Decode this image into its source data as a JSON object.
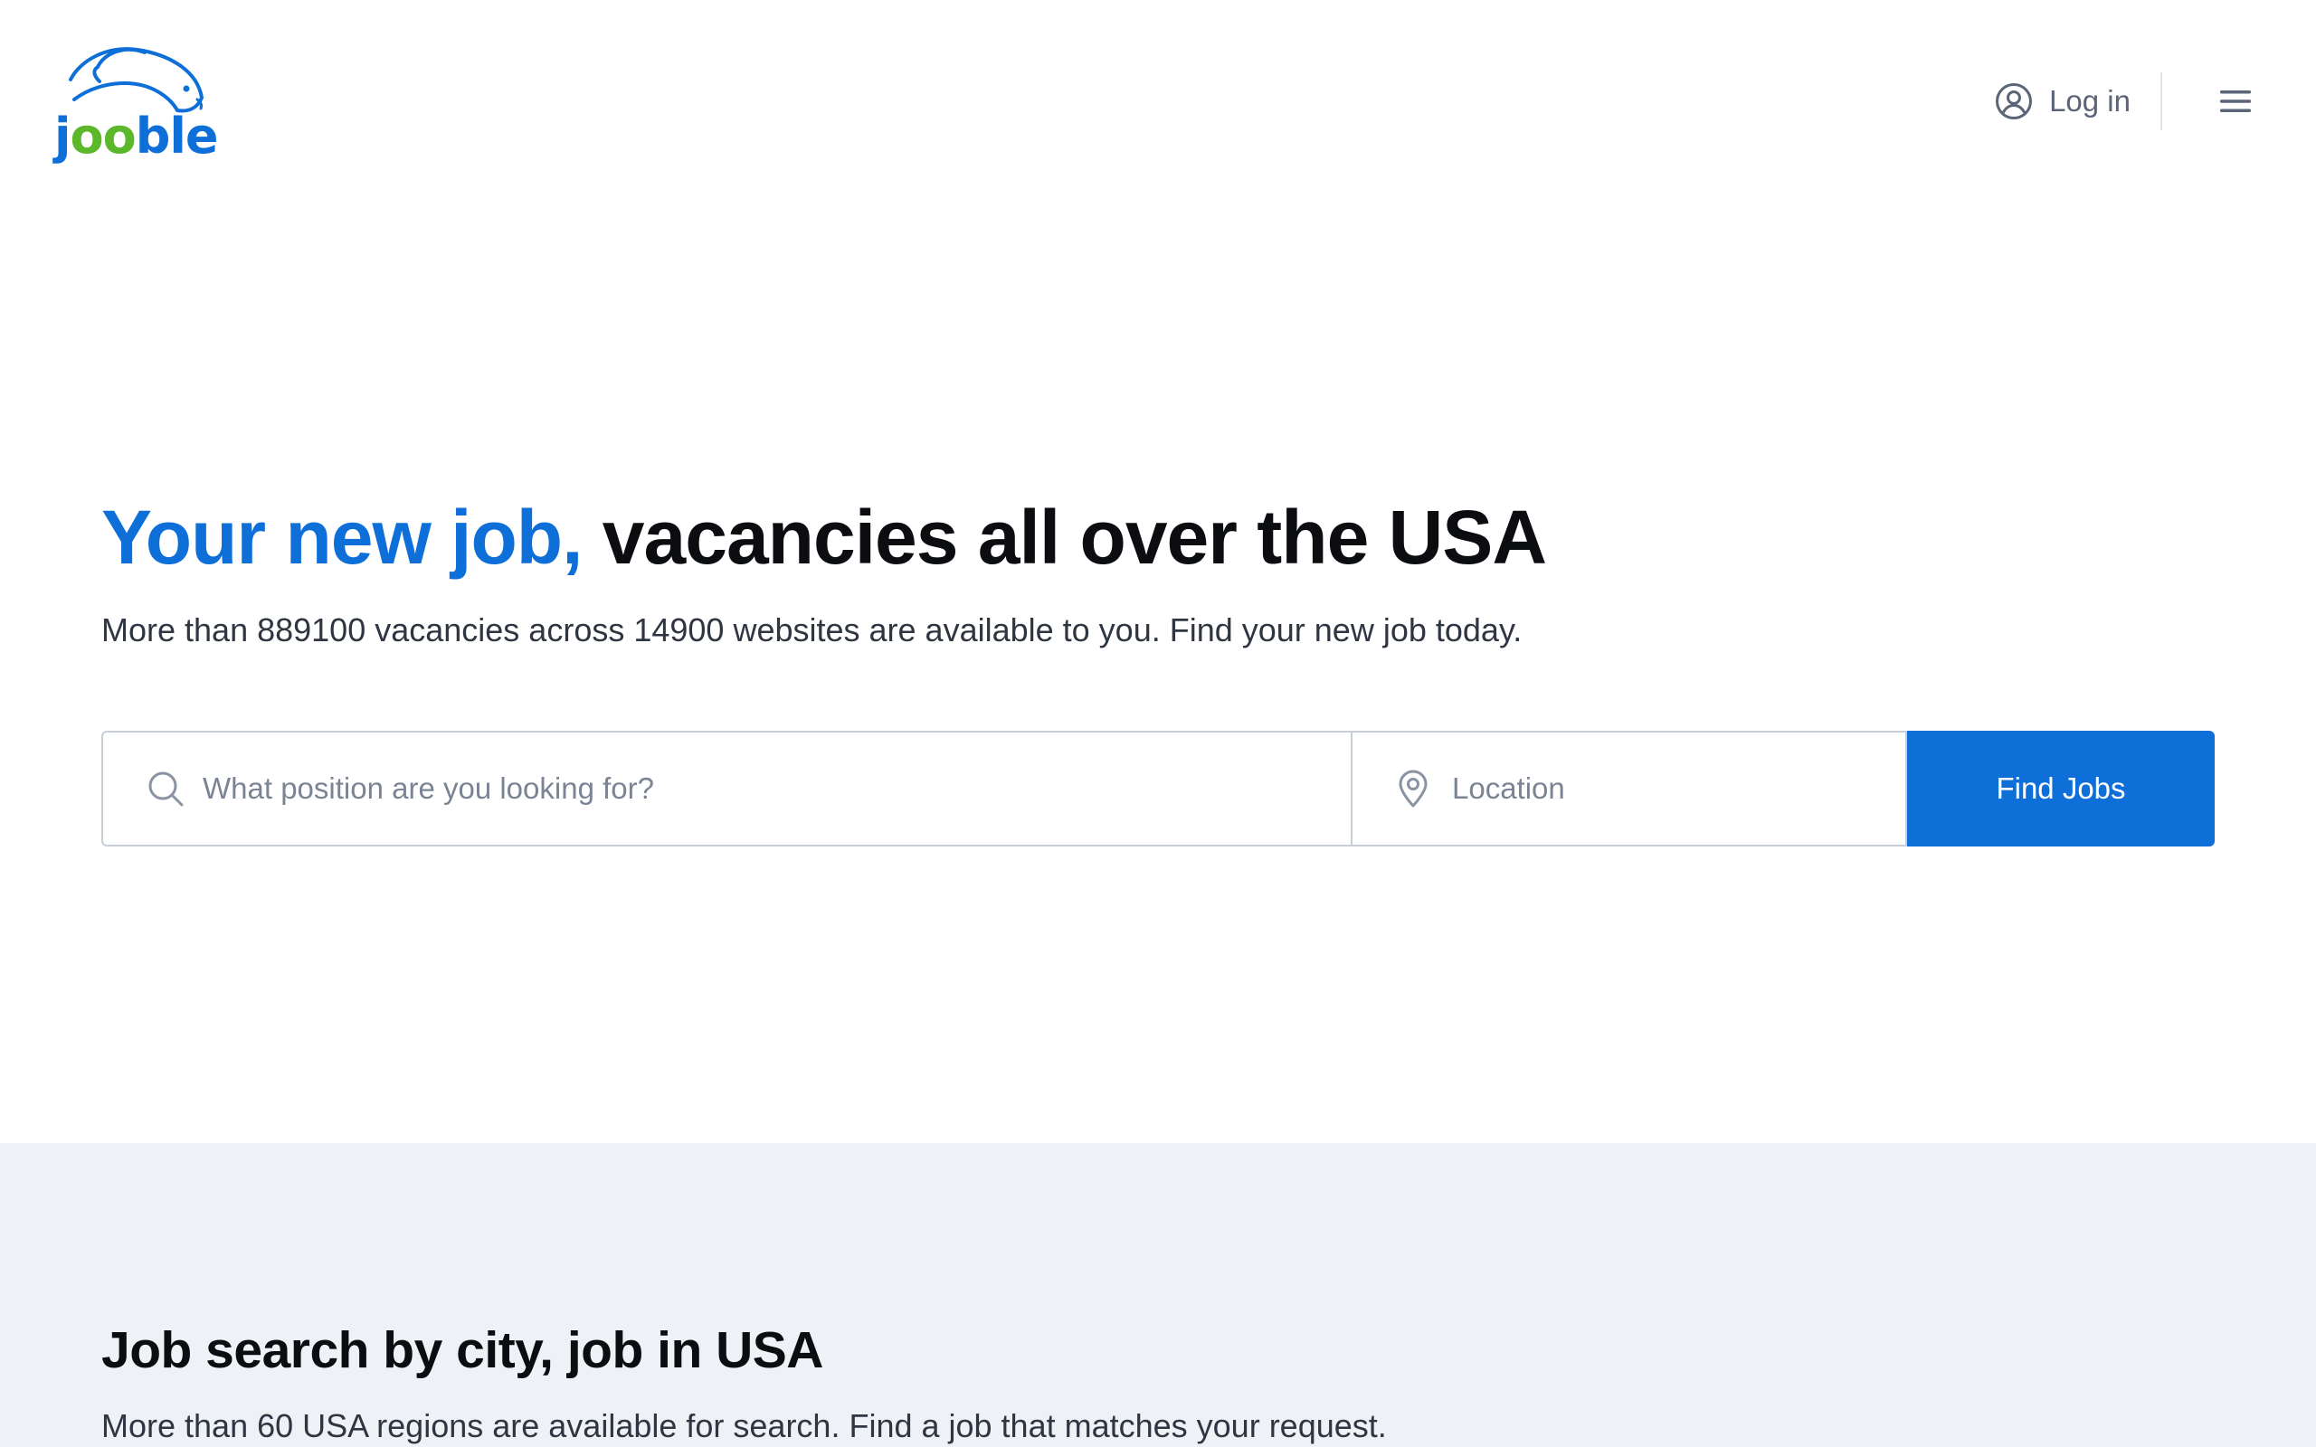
{
  "header": {
    "logo_text_parts": [
      "j",
      "oo",
      "ble"
    ],
    "login_label": "Log in",
    "menu_icon": "hamburger-menu-icon",
    "login_icon": "user-circle-icon"
  },
  "hero": {
    "title_accent": "Your new job,",
    "title_rest": "vacancies all over the USA",
    "subtitle": "More than 889100 vacancies across 14900 websites are available to you. Find your new job today."
  },
  "search": {
    "position_placeholder": "What position are you looking for?",
    "position_value": "",
    "location_placeholder": "Location",
    "location_value": "",
    "submit_label": "Find Jobs",
    "position_icon": "search-icon",
    "location_icon": "location-pin-icon"
  },
  "city_section": {
    "title": "Job search by city, job in USA",
    "subtitle": "More than 60 USA regions are available for search. Find a job that matches your request."
  },
  "colors": {
    "brand_blue": "#0d6fd7",
    "brand_green": "#5cb82a",
    "section_bg": "#eef1f6",
    "muted_text": "#5b6577"
  }
}
